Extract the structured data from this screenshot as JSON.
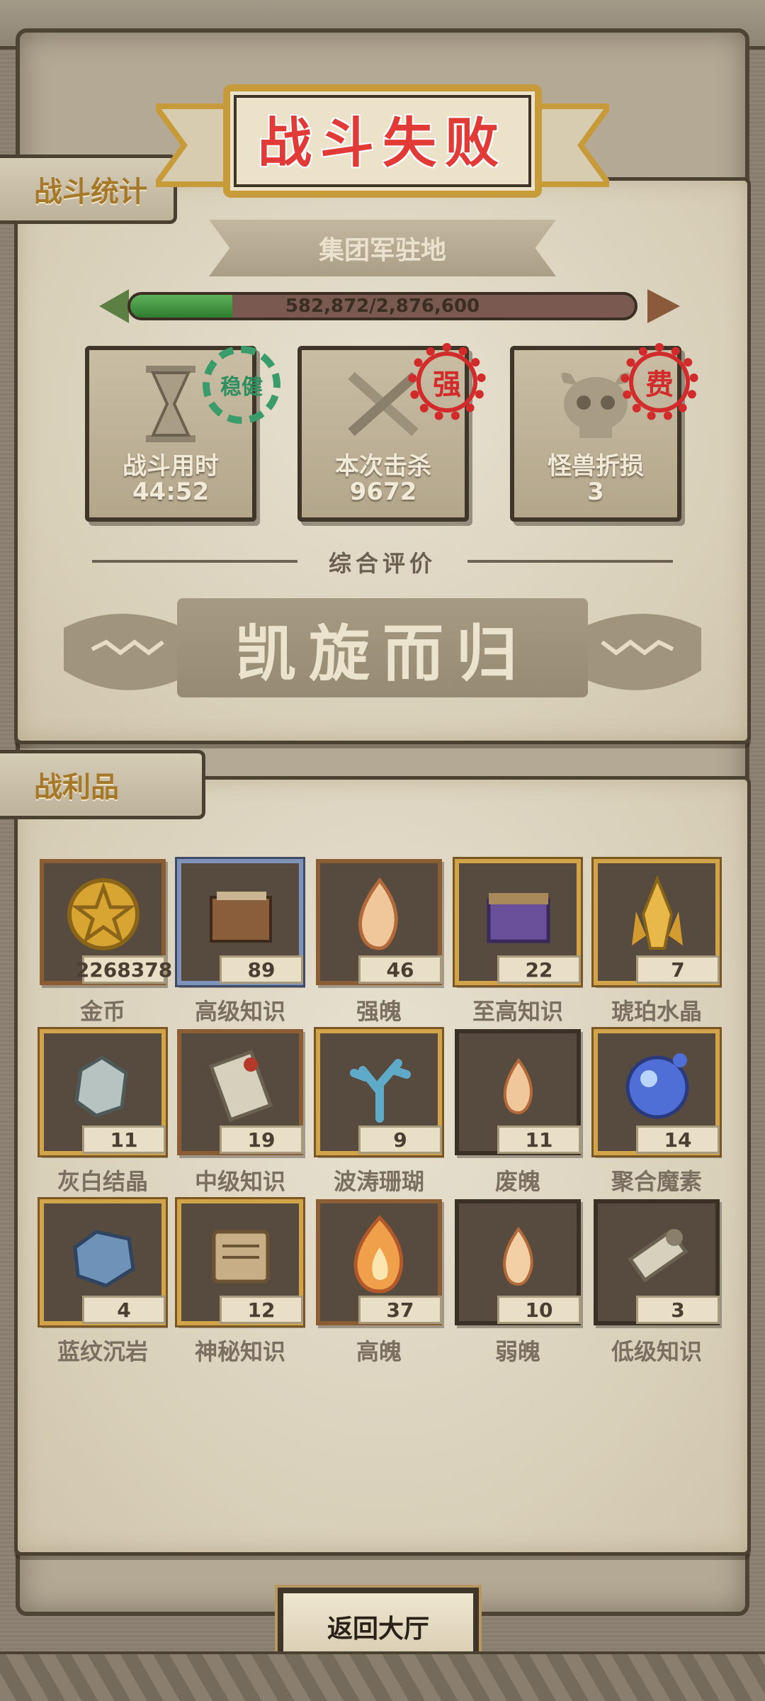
{
  "screen": {
    "title": "战斗失败",
    "accent_red": "#e23a37",
    "accent_gold": "#a5782a"
  },
  "stats_section": {
    "tab_label": "战斗统计",
    "location": "集团军驻地",
    "progress": {
      "label": "582,872/2,876,600",
      "current": 582872,
      "total": 2876600,
      "fill_fraction": 0.2026
    },
    "cards": [
      {
        "icon": "hourglass-icon",
        "label": "战斗用时",
        "value": "44:52",
        "stamp": "稳健",
        "stamp_style": "green"
      },
      {
        "icon": "crossed-swords-icon",
        "label": "本次击杀",
        "value": "9672",
        "stamp": "强",
        "stamp_style": "red"
      },
      {
        "icon": "horned-skull-icon",
        "label": "怪兽折损",
        "value": "3",
        "stamp": "费",
        "stamp_style": "red"
      }
    ],
    "evaluation_label": "综合评价",
    "rating": "凯旋而归"
  },
  "loot_section": {
    "tab_label": "战利品",
    "items": [
      {
        "name": "金币",
        "count": "2268378",
        "icon": "gold-coin-icon",
        "frame": "brown"
      },
      {
        "name": "高级知识",
        "count": "89",
        "icon": "book-icon",
        "frame": "blue"
      },
      {
        "name": "强魄",
        "count": "46",
        "icon": "flame-icon",
        "frame": "brown"
      },
      {
        "name": "至高知识",
        "count": "22",
        "icon": "tome-chest-icon",
        "frame": "gold"
      },
      {
        "name": "琥珀水晶",
        "count": "7",
        "icon": "amber-crystal-icon",
        "frame": "gold"
      },
      {
        "name": "灰白结晶",
        "count": "11",
        "icon": "grey-crystal-icon",
        "frame": "gold"
      },
      {
        "name": "中级知识",
        "count": "19",
        "icon": "scroll-icon",
        "frame": "brown"
      },
      {
        "name": "波涛珊瑚",
        "count": "9",
        "icon": "coral-icon",
        "frame": "gold"
      },
      {
        "name": "废魄",
        "count": "11",
        "icon": "small-flame-icon",
        "frame": "plain"
      },
      {
        "name": "聚合魔素",
        "count": "14",
        "icon": "magic-orb-icon",
        "frame": "gold"
      },
      {
        "name": "蓝纹沉岩",
        "count": "4",
        "icon": "blue-rock-icon",
        "frame": "gold"
      },
      {
        "name": "神秘知识",
        "count": "12",
        "icon": "ancient-tablet-icon",
        "frame": "gold"
      },
      {
        "name": "高魄",
        "count": "37",
        "icon": "big-flame-icon",
        "frame": "brown"
      },
      {
        "name": "弱魄",
        "count": "10",
        "icon": "weak-flame-icon",
        "frame": "plain"
      },
      {
        "name": "低级知识",
        "count": "3",
        "icon": "rolled-scroll-icon",
        "frame": "plain"
      }
    ]
  },
  "back_button_label": "返回大厅"
}
